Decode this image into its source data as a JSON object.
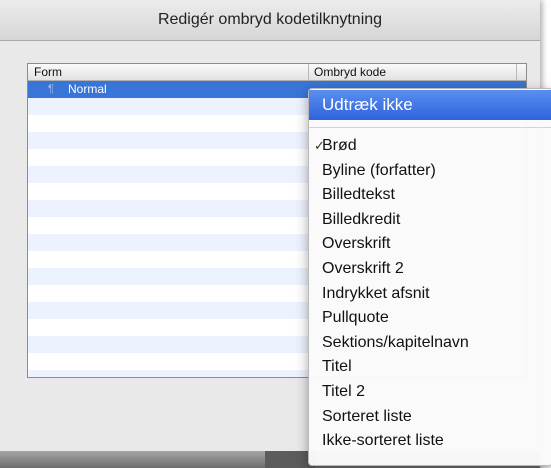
{
  "window": {
    "title": "Redigér ombryd kodetilknytning"
  },
  "table": {
    "columns": [
      "Form",
      "Ombryd kode"
    ],
    "rows": [
      {
        "name": "Normal",
        "selected": true
      }
    ],
    "empty_row_count": 17
  },
  "popup": {
    "highlighted": "Udtræk ikke",
    "checked_item": "Brød",
    "checkmark": "✓",
    "items": [
      "Brød",
      "Byline (forfatter)",
      "Billedtekst",
      "Billedkredit",
      "Overskrift",
      "Overskrift 2",
      "Indrykket afsnit",
      "Pullquote",
      "Sektions/kapitelnavn",
      "Titel",
      "Titel 2",
      "Sorteret liste",
      "Ikke-sorteret liste"
    ]
  },
  "colors": {
    "selection": "#3875d7",
    "menu_highlight": "#3e74e6",
    "row_alt": "#edf3fe"
  },
  "icons": {
    "row_style_icon": "paragraph-style-icon"
  }
}
